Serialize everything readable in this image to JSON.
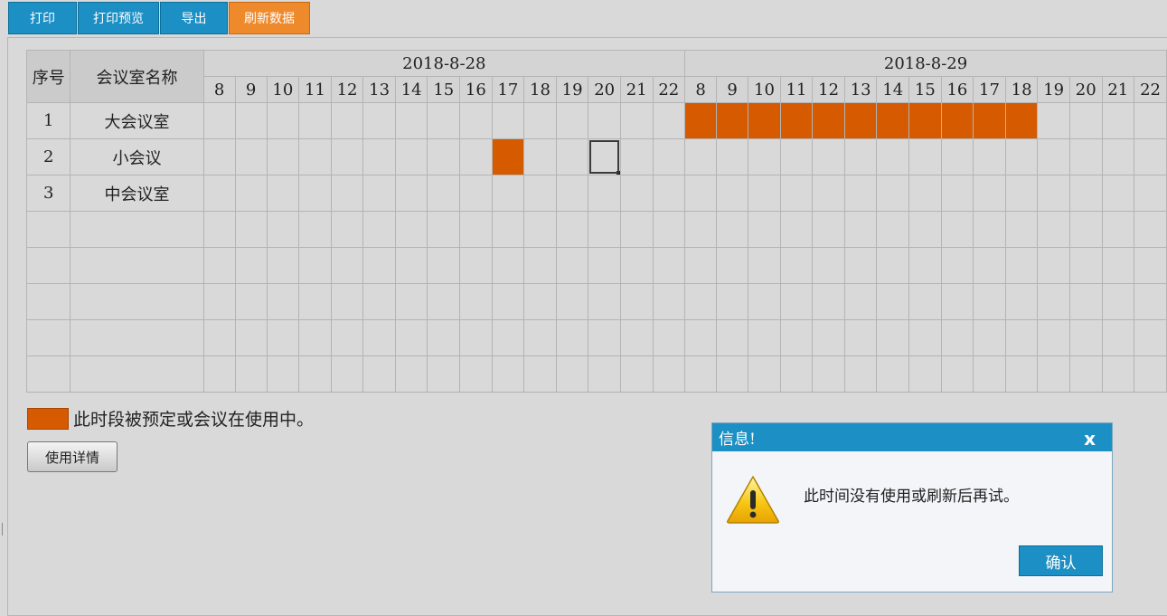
{
  "toolbar": {
    "print": "打印",
    "print_preview": "打印预览",
    "export": "导出",
    "refresh": "刷新数据"
  },
  "grid": {
    "col_index": "序号",
    "col_room": "会议室名称",
    "dates": [
      {
        "label": "2018-8-28",
        "hours": [
          "8",
          "9",
          "10",
          "11",
          "12",
          "13",
          "14",
          "15",
          "16",
          "17",
          "18",
          "19",
          "20",
          "21",
          "22"
        ]
      },
      {
        "label": "2018-8-29",
        "hours": [
          "8",
          "9",
          "10",
          "11",
          "12",
          "13",
          "14",
          "15",
          "16",
          "17",
          "18",
          "19",
          "20",
          "21",
          "22"
        ]
      }
    ],
    "rows": [
      {
        "index": "1",
        "name": "大会议室",
        "booked": [
          {
            "date": 1,
            "hours": [
              "8",
              "9",
              "10",
              "11",
              "12",
              "13",
              "14",
              "15",
              "16",
              "17",
              "18"
            ]
          }
        ]
      },
      {
        "index": "2",
        "name": "小会议",
        "booked": [
          {
            "date": 0,
            "hours": [
              "17"
            ]
          }
        ],
        "selected": {
          "date": 0,
          "hour": "20"
        }
      },
      {
        "index": "3",
        "name": "中会议室",
        "booked": []
      },
      {
        "index": "",
        "name": "",
        "booked": []
      },
      {
        "index": "",
        "name": "",
        "booked": []
      },
      {
        "index": "",
        "name": "",
        "booked": []
      },
      {
        "index": "",
        "name": "",
        "booked": []
      },
      {
        "index": "",
        "name": "",
        "booked": []
      }
    ]
  },
  "legend": {
    "text": "此时段被预定或会议在使用中。",
    "color": "#d55a00"
  },
  "detail_button": "使用详情",
  "dialog": {
    "title": "信息!",
    "close": "x",
    "icon": "warning-icon",
    "message": "此时间没有使用或刷新后再试。",
    "ok": "确认"
  },
  "colors": {
    "accent": "#1c8fc4",
    "refresh": "#ee8a2c",
    "booked": "#d55a00"
  }
}
